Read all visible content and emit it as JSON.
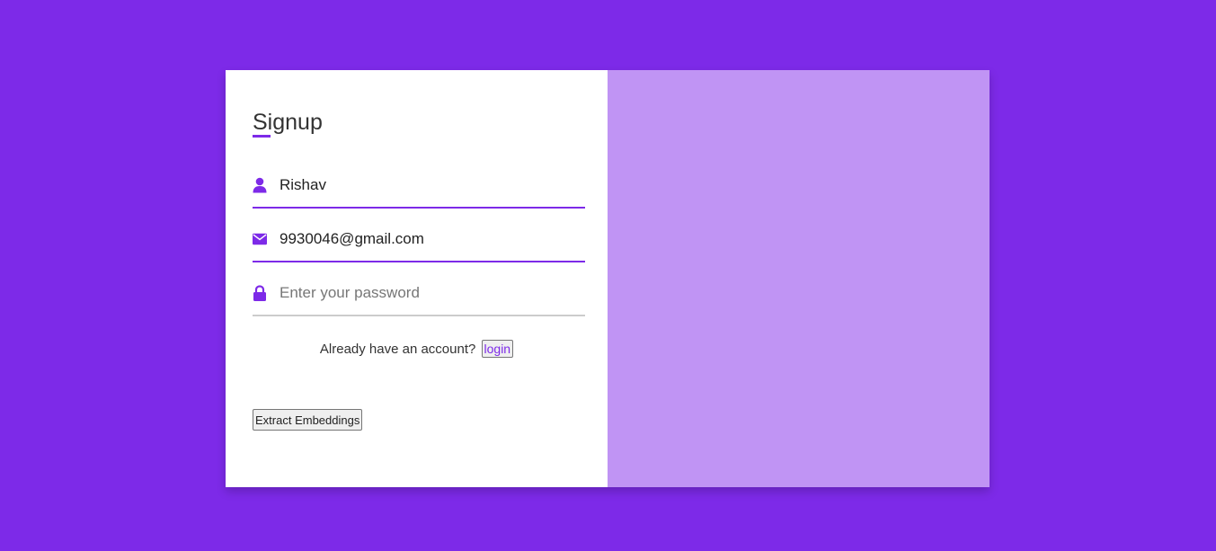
{
  "form": {
    "title": "Signup",
    "name_value": "Rishav",
    "email_value": "9930046@gmail.com",
    "password_value": "",
    "password_placeholder": "Enter your password",
    "account_prompt": "Already have an account?",
    "login_label": "login",
    "extract_label": "Extract Embeddings"
  },
  "icons": {
    "name": "user-icon",
    "email": "envelope-icon",
    "password": "lock-icon"
  },
  "colors": {
    "background": "#7d2ae8",
    "accent": "#7d2ae8",
    "image_panel": "#c094f4",
    "card": "#ffffff"
  }
}
